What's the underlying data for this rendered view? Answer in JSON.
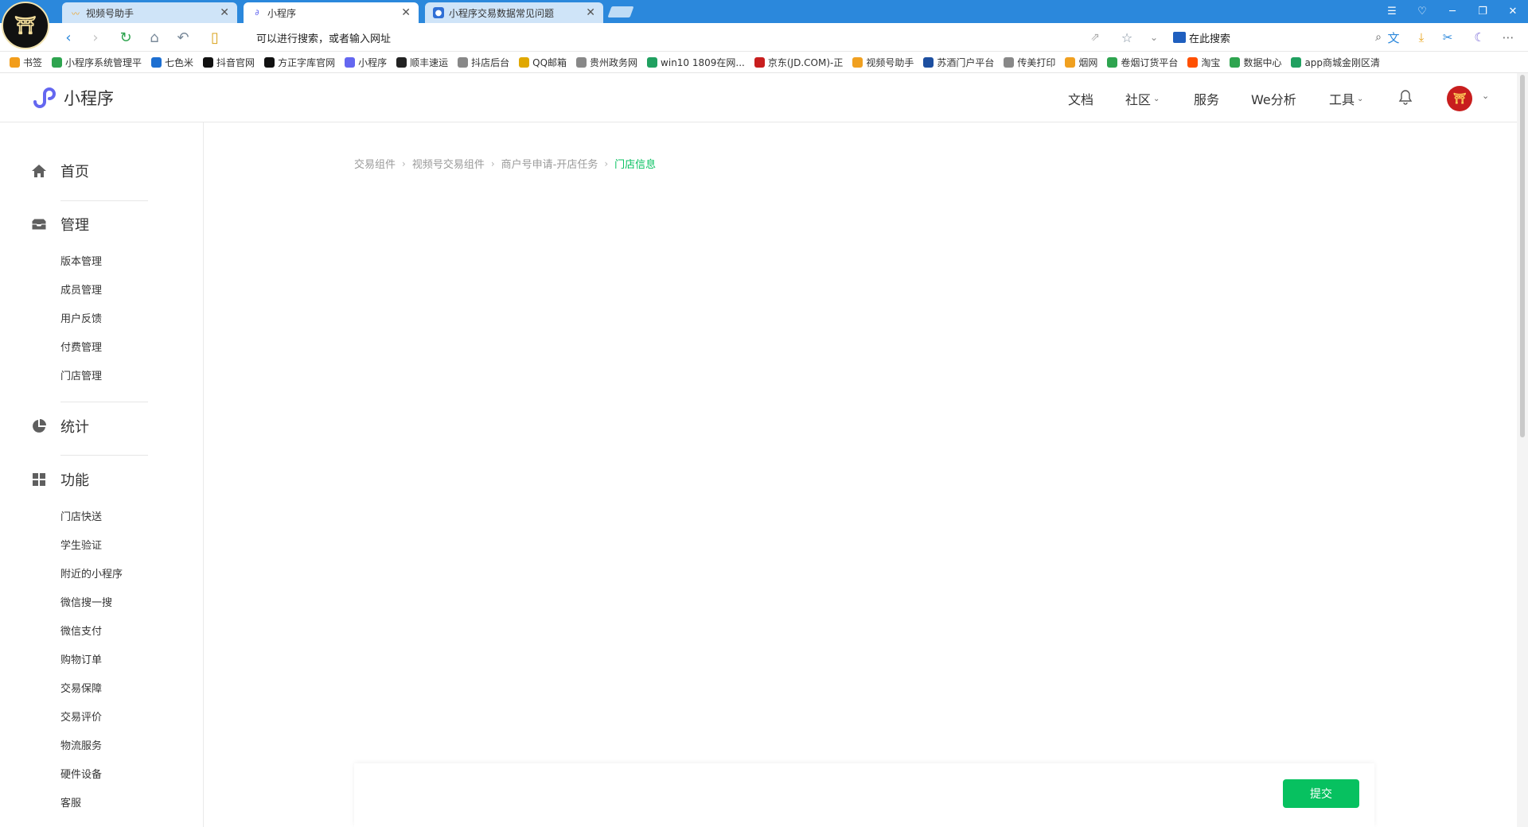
{
  "browser": {
    "tabs": [
      {
        "title": "视频号助手",
        "icon": "wave-icon"
      },
      {
        "title": "小程序",
        "icon": "miniprogram-icon"
      },
      {
        "title": "小程序交易数据常见问题",
        "icon": "paw-icon"
      }
    ],
    "address": "可以进行搜索，或者输入网址",
    "search_placeholder": "在此搜索",
    "bookmarks": [
      {
        "label": "书签",
        "color": "#f29d1a"
      },
      {
        "label": "小程序系统管理平",
        "color": "#2ea44f"
      },
      {
        "label": "七色米",
        "color": "#1d6fd1"
      },
      {
        "label": "抖音官网",
        "color": "#111111"
      },
      {
        "label": "方正字库官网",
        "color": "#111111"
      },
      {
        "label": "小程序",
        "color": "#6467f0"
      },
      {
        "label": "顺丰速运",
        "color": "#222222"
      },
      {
        "label": "抖店后台",
        "color": "#888888"
      },
      {
        "label": "QQ邮箱",
        "color": "#e0a800"
      },
      {
        "label": "贵州政务网",
        "color": "#888888"
      },
      {
        "label": "win10 1809在网...",
        "color": "#20a060"
      },
      {
        "label": "京东(JD.COM)-正",
        "color": "#c81e1e"
      },
      {
        "label": "视频号助手",
        "color": "#f0a020"
      },
      {
        "label": "苏酒门户平台",
        "color": "#1d4fa0"
      },
      {
        "label": "传美打印",
        "color": "#888888"
      },
      {
        "label": "烟网",
        "color": "#f0a020"
      },
      {
        "label": "卷烟订货平台",
        "color": "#2ea44f"
      },
      {
        "label": "淘宝",
        "color": "#ff5000"
      },
      {
        "label": "数据中心",
        "color": "#2ea44f"
      },
      {
        "label": "app商城金刚区清",
        "color": "#20a060"
      }
    ]
  },
  "header": {
    "brand": "小程序",
    "nav": {
      "docs": "文档",
      "community": "社区",
      "service": "服务",
      "we_analysis": "We分析",
      "tools": "工具"
    }
  },
  "sidebar": {
    "home": "首页",
    "manage": "管理",
    "manage_items": [
      "版本管理",
      "成员管理",
      "用户反馈",
      "付费管理",
      "门店管理"
    ],
    "stats": "统计",
    "features": "功能",
    "feature_items": [
      "门店快送",
      "学生验证",
      "附近的小程序",
      "微信搜一搜",
      "微信支付",
      "购物订单",
      "交易保障",
      "交易评价",
      "物流服务",
      "硬件设备",
      "客服"
    ]
  },
  "breadcrumb": [
    "交易组件",
    "视频号交易组件",
    "商户号申请-开店任务",
    "门店信息"
  ],
  "actions": {
    "submit": "提交"
  },
  "colors": {
    "accent": "#07c160",
    "titlebar": "#2b88dc",
    "brand": "#6467f0"
  }
}
